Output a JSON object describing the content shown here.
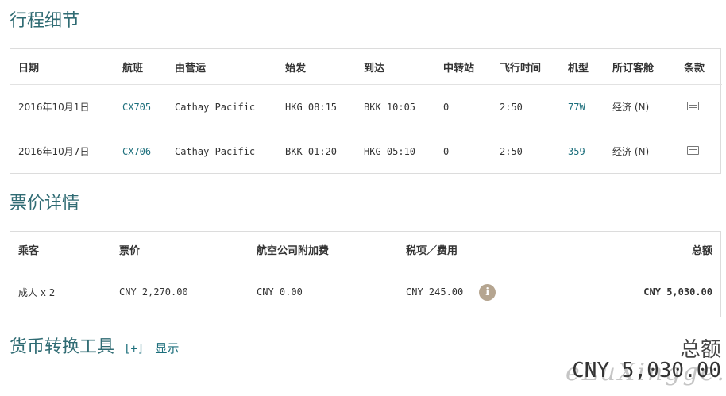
{
  "itinerary": {
    "title": "行程细节",
    "headers": {
      "date": "日期",
      "flight": "航班",
      "operator": "由营运",
      "depart": "始发",
      "arrive": "到达",
      "stops": "中转站",
      "duration": "飞行时间",
      "aircraft": "机型",
      "cabin": "所订客舱",
      "rules": "条款"
    },
    "flights": [
      {
        "date": "2016年10月1日",
        "flight": "CX705",
        "operator": "Cathay Pacific",
        "depart": "HKG 08:15",
        "arrive": "BKK 10:05",
        "stops": "0",
        "duration": "2:50",
        "aircraft": "77W",
        "cabin": "经济 (N)",
        "rules_icon": "document-icon"
      },
      {
        "date": "2016年10月7日",
        "flight": "CX706",
        "operator": "Cathay Pacific",
        "depart": "BKK 01:20",
        "arrive": "HKG 05:10",
        "stops": "0",
        "duration": "2:50",
        "aircraft": "359",
        "cabin": "经济 (N)",
        "rules_icon": "document-icon"
      }
    ]
  },
  "fare": {
    "title": "票价详情",
    "headers": {
      "passenger": "乘客",
      "fare": "票价",
      "surcharge": "航空公司附加费",
      "taxes": "税项／费用",
      "total": "总额"
    },
    "row": {
      "passenger": "成人 x 2",
      "fare": "CNY 2,270.00",
      "surcharge": "CNY 0.00",
      "taxes": "CNY 245.00",
      "info_icon": "i",
      "total": "CNY 5,030.00"
    }
  },
  "converter": {
    "title": "货币转换工具",
    "toggle": "[+]",
    "show": "显示"
  },
  "grand_total": {
    "label": "总额",
    "value": "CNY 5,030.00"
  },
  "watermark": "eLuXingge.cc",
  "colors": {
    "accent": "#2f6b73",
    "link": "#1d6f7c",
    "info": "#b5a590"
  }
}
